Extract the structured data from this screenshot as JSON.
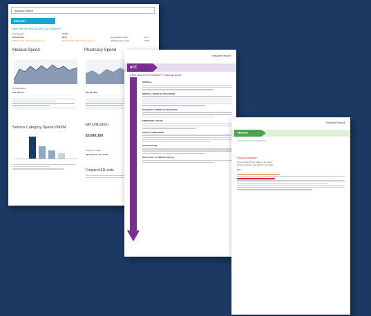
{
  "report_label": "Insights Report",
  "page1": {
    "banner": "IDENTIFY",
    "question": "WHAT ARE MY HEALTHCARE COST DRIVERS?",
    "total_spend_label": "Total Spend",
    "total_spend_value": "$50,821,904",
    "total_spend_change": "30% increase from previous period",
    "pmpm_label": "PMPM",
    "pmpm_value": "$146",
    "pmpm_change": "33% increase from previous period",
    "members_label": "Avg Member Count",
    "members_value": "2,477",
    "member_count_label": "Total Member Count",
    "member_count_value": "7,678",
    "medical_title": "Medical Spend",
    "pharmacy_title": "Pharmacy Spend",
    "annual_spend_label": "Annual Spend",
    "annual_spend_value": "$41,276,134",
    "pharm_annual_value": "$10,193,880",
    "service_title": "Service Category Spend PMPM",
    "er_title": "ER Utilization",
    "er_total_spend": "$3,846,369",
    "er_visits_label": "Number of visits",
    "er_visits_value": "490 ER visits per 1,000",
    "frequent_title": "Frequent ER visits"
  },
  "page2": {
    "banner": "ACT",
    "title": "DATA ANALYSIS SUMMARY: Challenge Areas",
    "sections": [
      "OVERALL",
      "MEDICAL SPEND & UTILIZATION",
      "PHARMACY SPEND & UTILIZATION",
      "EMERGENCY ROOM",
      "COSTLY CONDITIONS",
      "GAPS IN CARE",
      "HIGH-COST CLAIMANTS (HCCs)"
    ]
  },
  "page3": {
    "banner": "TRACK",
    "subtitle": "Trending report on conformance",
    "red_title": "Report available",
    "lines": [
      "Current Period: Feb 2023 to Jan 2024",
      "Previous Period: Feb 2022 to Jan 2023"
    ],
    "key_label": "Key"
  }
}
